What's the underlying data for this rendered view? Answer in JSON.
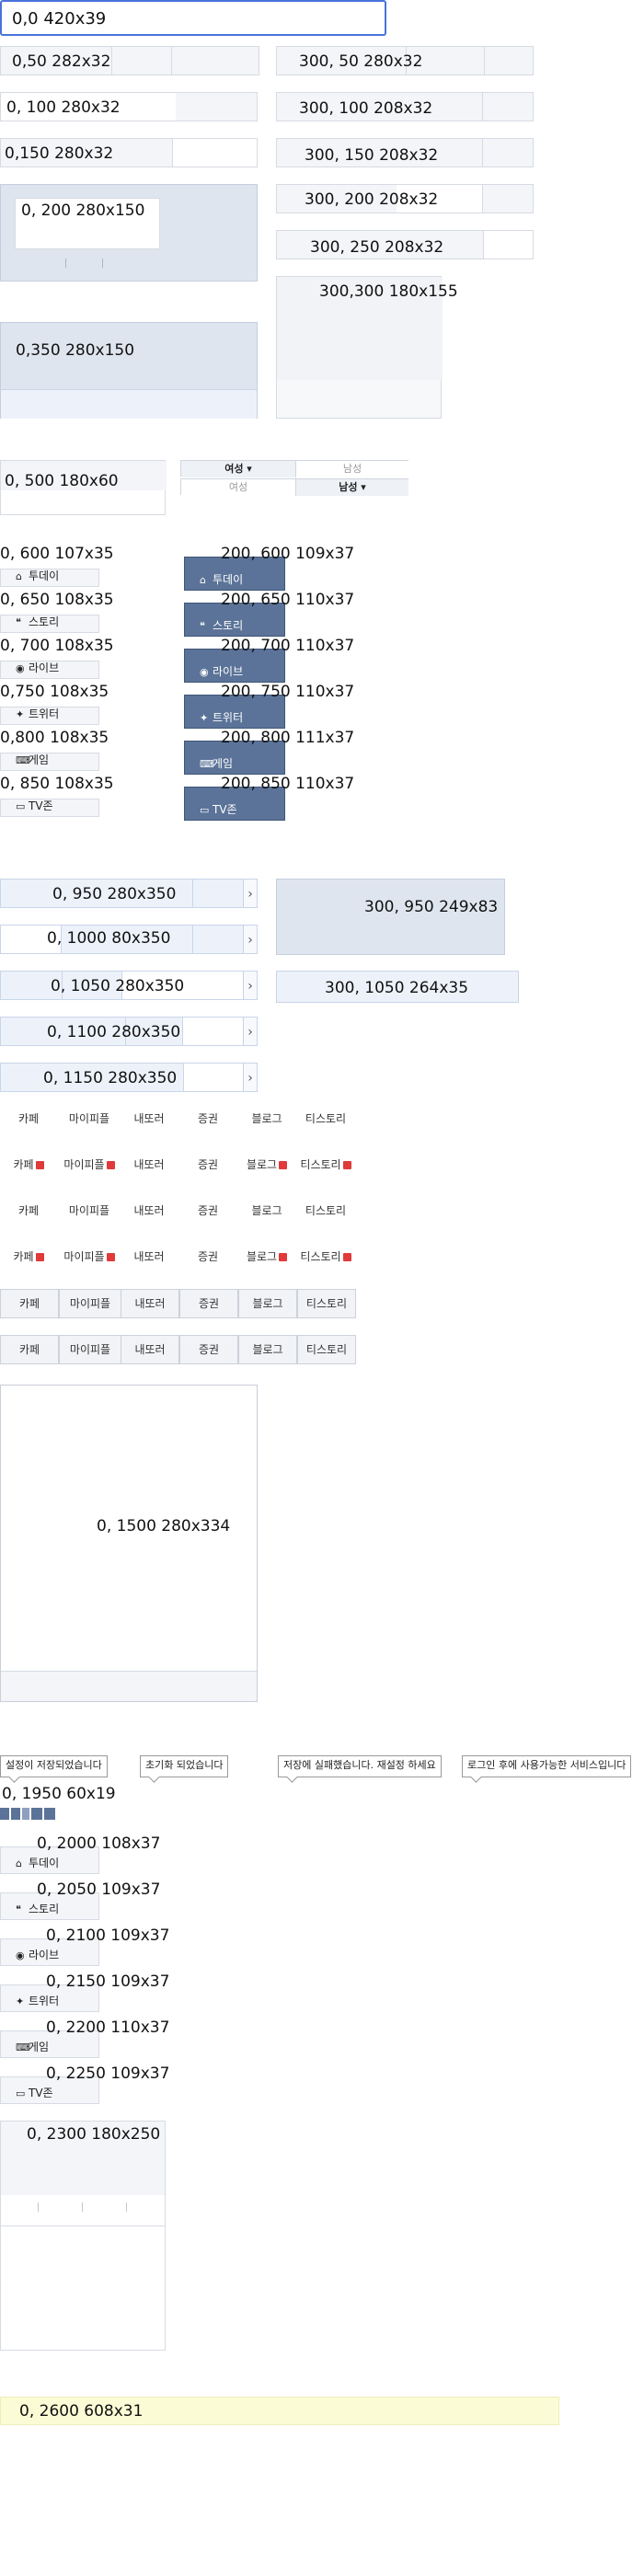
{
  "boxes": {
    "b0": "0,0 420x39",
    "b1": "0,50 282x32",
    "b2": "0, 100 280x32",
    "b3": "0,150 280x32",
    "b4": "0, 200 280x150",
    "b5": "0,350 280x150",
    "b6": "0, 500 180x60",
    "r1": "300, 50 280x32",
    "r2": "300, 100 208x32",
    "r3": "300, 150 208x32",
    "r4": "300, 200 208x32",
    "r5": "300, 250 208x32",
    "r6": "300,300 180x155"
  },
  "gender": {
    "female": "여성 ▾",
    "male": "남성",
    "female2": "여성",
    "male2": "남성 ▾"
  },
  "nav_left": [
    {
      "coord": "0, 600 107x35",
      "label": "투데이",
      "icon": "home-icon",
      "glyph": "⌂"
    },
    {
      "coord": "0, 650 108x35",
      "label": "스토리",
      "icon": "story-icon",
      "glyph": "❝"
    },
    {
      "coord": "0, 700 108x35",
      "label": "라이브",
      "icon": "eye-icon",
      "glyph": "◉"
    },
    {
      "coord": "0,750 108x35",
      "label": "트위터",
      "icon": "twitter-icon",
      "glyph": "✦"
    },
    {
      "coord": "0,800 108x35",
      "label": "게임",
      "icon": "gamepad-icon",
      "glyph": "⌨"
    },
    {
      "coord": "0, 850 108x35",
      "label": "TV존",
      "icon": "tv-icon",
      "glyph": "▭"
    }
  ],
  "nav_right": [
    {
      "coord": "200, 600 109x37",
      "label": "투데이",
      "icon": "home-icon",
      "glyph": "⌂"
    },
    {
      "coord": "200, 650 110x37",
      "label": "스토리",
      "icon": "story-icon",
      "glyph": "❝"
    },
    {
      "coord": "200, 700 110x37",
      "label": "라이브",
      "icon": "eye-icon",
      "glyph": "◉"
    },
    {
      "coord": "200, 750 110x37",
      "label": "트위터",
      "icon": "twitter-icon",
      "glyph": "✦"
    },
    {
      "coord": "200, 800 111x37",
      "label": "게임",
      "icon": "gamepad-icon",
      "glyph": "⌨"
    },
    {
      "coord": "200, 850 110x37",
      "label": "TV존",
      "icon": "tv-icon",
      "glyph": "▭"
    }
  ],
  "selects": {
    "s1": "0, 950 280x350",
    "s2": "0, 1000 80x350",
    "s3": "0, 1050  280x350",
    "s4": "0, 1100 280x350",
    "s5": "0, 1150 280x350",
    "p1": "300, 950 249x83",
    "p2": "300, 1050 264x35"
  },
  "tabs": [
    "카페",
    "마이피플",
    "내또러",
    "증권",
    "블로그",
    "티스토리"
  ],
  "panel": "0, 1500 280x334",
  "tooltips": [
    "설정이 저장되었습니다",
    "초기화 되었습니다",
    "저장에 실패했습니다. 재설정 하세요",
    "로그인 후에 사용가능한 서비스입니다"
  ],
  "b1950": "0, 1950 60x19",
  "nav_small": [
    {
      "coord": "0, 2000 108x37",
      "label": "투데이",
      "icon": "home-icon",
      "glyph": "⌂"
    },
    {
      "coord": "0, 2050 109x37",
      "label": "스토리",
      "icon": "story-icon",
      "glyph": "❝"
    },
    {
      "coord": "0, 2100 109x37",
      "label": "라이브",
      "icon": "eye-icon",
      "glyph": "◉"
    },
    {
      "coord": "0, 2150 109x37",
      "label": "트위터",
      "icon": "twitter-icon",
      "glyph": "✦"
    },
    {
      "coord": "0, 2200 110x37",
      "label": "게임",
      "icon": "gamepad-icon",
      "glyph": "⌨"
    },
    {
      "coord": "0, 2250 109x37",
      "label": "TV존",
      "icon": "tv-icon",
      "glyph": "▭"
    }
  ],
  "b2300": "0, 2300 180x250",
  "b2600": "0, 2600 608x31"
}
